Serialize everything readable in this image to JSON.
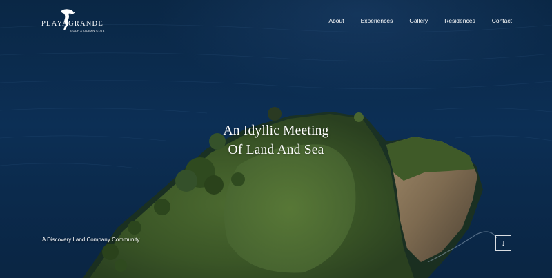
{
  "brand": {
    "word_left": "PLAYA",
    "word_right": "GRANDE",
    "subtitle": "GOLF & OCEAN CLUB",
    "logo_icon": "figure-logo-icon"
  },
  "nav": {
    "items": [
      {
        "label": "About"
      },
      {
        "label": "Experiences"
      },
      {
        "label": "Gallery"
      },
      {
        "label": "Residences"
      },
      {
        "label": "Contact"
      }
    ]
  },
  "hero": {
    "headline_line1": "An Idyllic Meeting",
    "headline_line2": "Of Land And Sea",
    "tagline": "A Discovery Land Company Community",
    "scroll_icon": "arrow-down-icon",
    "scroll_glyph": "↓"
  },
  "colors": {
    "ocean": "#0b2a4c",
    "fairway": "#3d5a2a",
    "text": "#ffffff"
  }
}
